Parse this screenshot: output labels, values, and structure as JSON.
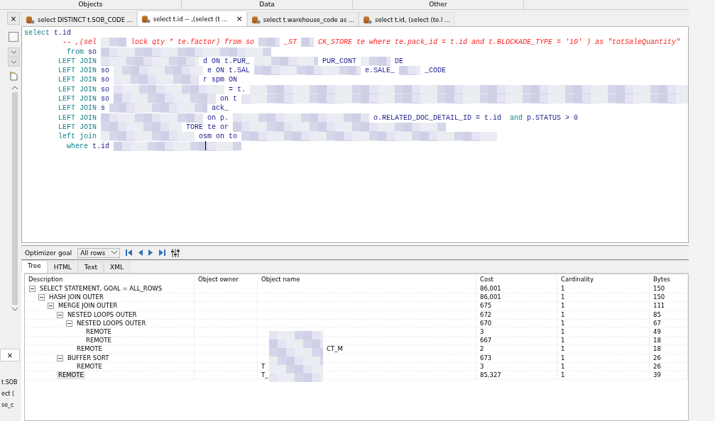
{
  "header": [
    "Objects",
    "Data",
    "Other"
  ],
  "side_panel": {
    "tab_close": "×",
    "items": [
      "t.SOB",
      "ect (",
      "se_c"
    ]
  },
  "tabs": [
    {
      "label": "select DISTINCT t.SOB_CODE ...",
      "selected": false,
      "closable": false
    },
    {
      "label": "select t.id -- ,(select (t ...",
      "selected": true,
      "closable": true
    },
    {
      "label": "select t.warehouse_code as ...",
      "selected": false,
      "closable": false
    },
    {
      "label": "select t.id, (select (te.l ...",
      "selected": false,
      "closable": false
    }
  ],
  "close_symbol": "×",
  "editor": {
    "lines": [
      [
        {
          "kind": "keyword",
          "text": "select"
        },
        {
          "kind": "text",
          "text": "t.id"
        }
      ],
      [
        {
          "kind": "comment",
          "text": "-- ,(sel"
        },
        {
          "kind": "comment",
          "text": "lock qty * te.factor) from so"
        },
        {
          "kind": "comment",
          "text": "_ST"
        },
        {
          "kind": "comment",
          "text": "CK_STORE te where te.pack_id = t.id and t.BLOCKADE_TYPE = '10' ) as \"totSaleQuantity\""
        }
      ],
      [
        {
          "kind": "keyword",
          "text": "from"
        },
        {
          "kind": "text",
          "text": "so"
        }
      ],
      [
        {
          "kind": "keyword",
          "text": "LEFT JOIN"
        },
        {
          "kind": "text",
          "text": "d ON t.PUR_"
        },
        {
          "kind": "text",
          "text": "PUR_CONT"
        },
        {
          "kind": "text",
          "text": "DE"
        }
      ],
      [
        {
          "kind": "keyword",
          "text": "LEFT JOIN"
        },
        {
          "kind": "text",
          "text": "so"
        },
        {
          "kind": "text",
          "text": "e ON t.SAL"
        },
        {
          "kind": "text",
          "text": "e.SALE_"
        },
        {
          "kind": "text",
          "text": "_CODE"
        }
      ],
      [
        {
          "kind": "keyword",
          "text": "LEFT JOIN"
        },
        {
          "kind": "text",
          "text": "so"
        },
        {
          "kind": "text",
          "text": "r spm ON"
        }
      ],
      [
        {
          "kind": "keyword",
          "text": "LEFT JOIN"
        },
        {
          "kind": "text",
          "text": "so"
        },
        {
          "kind": "text",
          "text": "= t."
        }
      ],
      [
        {
          "kind": "keyword",
          "text": "LEFT JOIN"
        },
        {
          "kind": "text",
          "text": "so"
        },
        {
          "kind": "text",
          "text": "on t"
        }
      ],
      [
        {
          "kind": "keyword",
          "text": "LEFT JOIN"
        },
        {
          "kind": "text",
          "text": "s"
        },
        {
          "kind": "text",
          "text": "ack_"
        }
      ],
      [
        {
          "kind": "keyword",
          "text": "LEFT JOIN"
        },
        {
          "kind": "text",
          "text": "on p."
        },
        {
          "kind": "text",
          "text": "o.RELATED_DOC_DETAIL_ID = t.id"
        },
        {
          "kind": "keyword",
          "text": "and"
        },
        {
          "kind": "text",
          "text": "p.STATUS > 0"
        }
      ],
      [
        {
          "kind": "keyword",
          "text": "LEFT JOIN"
        },
        {
          "kind": "text",
          "text": "TORE te or"
        }
      ],
      [
        {
          "kind": "keyword",
          "text": "left join"
        },
        {
          "kind": "text",
          "text": "osm on to"
        }
      ],
      [
        {
          "kind": "keyword",
          "text": "where"
        },
        {
          "kind": "text",
          "text": "t.id"
        }
      ]
    ]
  },
  "optimizer": {
    "label": "Optimizer goal",
    "value": "All rows"
  },
  "plan_tabs": [
    {
      "label": "Tree",
      "selected": true
    },
    {
      "label": "HTML",
      "selected": false
    },
    {
      "label": "Text",
      "selected": false
    },
    {
      "label": "XML",
      "selected": false
    }
  ],
  "plan": {
    "columns": [
      "Description",
      "Object owner",
      "Object name",
      "Cost",
      "Cardinality",
      "Bytes"
    ],
    "rows": [
      {
        "description": "SELECT STATEMENT, GOAL = ALL_ROWS",
        "cost": "86,001",
        "cardinality": "1",
        "bytes": "150",
        "selected": false,
        "expanded": true,
        "children": [
          {
            "description": "HASH JOIN OUTER",
            "cost": "86,001",
            "cardinality": "1",
            "bytes": "150",
            "selected": false,
            "expanded": true,
            "children": [
              {
                "description": "MERGE JOIN OUTER",
                "cost": "675",
                "cardinality": "1",
                "bytes": "111",
                "selected": false,
                "expanded": true,
                "children": [
                  {
                    "description": "NESTED LOOPS OUTER",
                    "cost": "672",
                    "cardinality": "1",
                    "bytes": "85",
                    "selected": false,
                    "expanded": true,
                    "children": [
                      {
                        "description": "NESTED LOOPS OUTER",
                        "cost": "670",
                        "cardinality": "1",
                        "bytes": "67",
                        "selected": false,
                        "expanded": true,
                        "children": [
                          {
                            "description": "REMOTE",
                            "cost": "3",
                            "cardinality": "1",
                            "bytes": "49",
                            "selected": false
                          },
                          {
                            "description": "REMOTE",
                            "cost": "667",
                            "cardinality": "1",
                            "bytes": "18",
                            "selected": false
                          }
                        ]
                      },
                      {
                        "description": "REMOTE",
                        "object_name": "CT_M",
                        "cost": "2",
                        "cardinality": "1",
                        "bytes": "18",
                        "selected": false
                      }
                    ]
                  },
                  {
                    "description": "BUFFER SORT",
                    "cost": "673",
                    "cardinality": "1",
                    "bytes": "26",
                    "selected": false,
                    "expanded": true,
                    "children": [
                      {
                        "description": "REMOTE",
                        "object_name": "T",
                        "cost": "3",
                        "cardinality": "1",
                        "bytes": "26",
                        "selected": false
                      }
                    ]
                  }
                ]
              },
              {
                "description": "REMOTE",
                "object_name": "T_",
                "cost": "85,327",
                "cardinality": "1",
                "bytes": "39",
                "selected": true
              }
            ]
          }
        ]
      }
    ]
  }
}
